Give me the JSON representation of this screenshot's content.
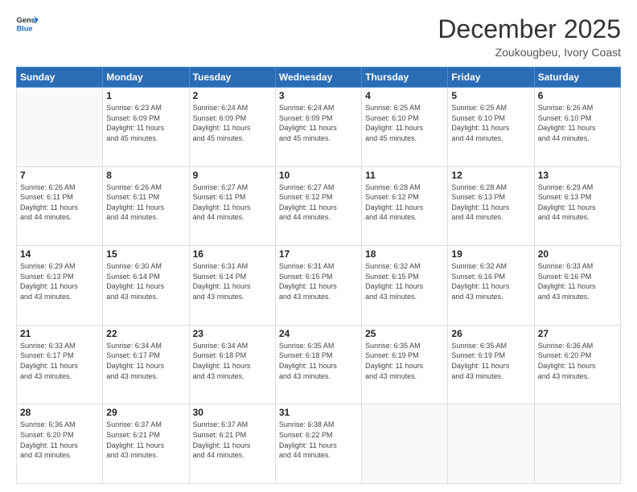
{
  "header": {
    "logo_general": "General",
    "logo_blue": "Blue",
    "title": "December 2025",
    "location": "Zoukougbeu, Ivory Coast"
  },
  "days_of_week": [
    "Sunday",
    "Monday",
    "Tuesday",
    "Wednesday",
    "Thursday",
    "Friday",
    "Saturday"
  ],
  "weeks": [
    [
      {
        "day": "",
        "info": ""
      },
      {
        "day": "1",
        "info": "Sunrise: 6:23 AM\nSunset: 6:09 PM\nDaylight: 11 hours\nand 45 minutes."
      },
      {
        "day": "2",
        "info": "Sunrise: 6:24 AM\nSunset: 6:09 PM\nDaylight: 11 hours\nand 45 minutes."
      },
      {
        "day": "3",
        "info": "Sunrise: 6:24 AM\nSunset: 6:09 PM\nDaylight: 11 hours\nand 45 minutes."
      },
      {
        "day": "4",
        "info": "Sunrise: 6:25 AM\nSunset: 6:10 PM\nDaylight: 11 hours\nand 45 minutes."
      },
      {
        "day": "5",
        "info": "Sunrise: 6:25 AM\nSunset: 6:10 PM\nDaylight: 11 hours\nand 44 minutes."
      },
      {
        "day": "6",
        "info": "Sunrise: 6:26 AM\nSunset: 6:10 PM\nDaylight: 11 hours\nand 44 minutes."
      }
    ],
    [
      {
        "day": "7",
        "info": "Sunrise: 6:26 AM\nSunset: 6:11 PM\nDaylight: 11 hours\nand 44 minutes."
      },
      {
        "day": "8",
        "info": "Sunrise: 6:26 AM\nSunset: 6:11 PM\nDaylight: 11 hours\nand 44 minutes."
      },
      {
        "day": "9",
        "info": "Sunrise: 6:27 AM\nSunset: 6:11 PM\nDaylight: 11 hours\nand 44 minutes."
      },
      {
        "day": "10",
        "info": "Sunrise: 6:27 AM\nSunset: 6:12 PM\nDaylight: 11 hours\nand 44 minutes."
      },
      {
        "day": "11",
        "info": "Sunrise: 6:28 AM\nSunset: 6:12 PM\nDaylight: 11 hours\nand 44 minutes."
      },
      {
        "day": "12",
        "info": "Sunrise: 6:28 AM\nSunset: 6:13 PM\nDaylight: 11 hours\nand 44 minutes."
      },
      {
        "day": "13",
        "info": "Sunrise: 6:29 AM\nSunset: 6:13 PM\nDaylight: 11 hours\nand 44 minutes."
      }
    ],
    [
      {
        "day": "14",
        "info": "Sunrise: 6:29 AM\nSunset: 6:13 PM\nDaylight: 11 hours\nand 43 minutes."
      },
      {
        "day": "15",
        "info": "Sunrise: 6:30 AM\nSunset: 6:14 PM\nDaylight: 11 hours\nand 43 minutes."
      },
      {
        "day": "16",
        "info": "Sunrise: 6:31 AM\nSunset: 6:14 PM\nDaylight: 11 hours\nand 43 minutes."
      },
      {
        "day": "17",
        "info": "Sunrise: 6:31 AM\nSunset: 6:15 PM\nDaylight: 11 hours\nand 43 minutes."
      },
      {
        "day": "18",
        "info": "Sunrise: 6:32 AM\nSunset: 6:15 PM\nDaylight: 11 hours\nand 43 minutes."
      },
      {
        "day": "19",
        "info": "Sunrise: 6:32 AM\nSunset: 6:16 PM\nDaylight: 11 hours\nand 43 minutes."
      },
      {
        "day": "20",
        "info": "Sunrise: 6:33 AM\nSunset: 6:16 PM\nDaylight: 11 hours\nand 43 minutes."
      }
    ],
    [
      {
        "day": "21",
        "info": "Sunrise: 6:33 AM\nSunset: 6:17 PM\nDaylight: 11 hours\nand 43 minutes."
      },
      {
        "day": "22",
        "info": "Sunrise: 6:34 AM\nSunset: 6:17 PM\nDaylight: 11 hours\nand 43 minutes."
      },
      {
        "day": "23",
        "info": "Sunrise: 6:34 AM\nSunset: 6:18 PM\nDaylight: 11 hours\nand 43 minutes."
      },
      {
        "day": "24",
        "info": "Sunrise: 6:35 AM\nSunset: 6:18 PM\nDaylight: 11 hours\nand 43 minutes."
      },
      {
        "day": "25",
        "info": "Sunrise: 6:35 AM\nSunset: 6:19 PM\nDaylight: 11 hours\nand 43 minutes."
      },
      {
        "day": "26",
        "info": "Sunrise: 6:35 AM\nSunset: 6:19 PM\nDaylight: 11 hours\nand 43 minutes."
      },
      {
        "day": "27",
        "info": "Sunrise: 6:36 AM\nSunset: 6:20 PM\nDaylight: 11 hours\nand 43 minutes."
      }
    ],
    [
      {
        "day": "28",
        "info": "Sunrise: 6:36 AM\nSunset: 6:20 PM\nDaylight: 11 hours\nand 43 minutes."
      },
      {
        "day": "29",
        "info": "Sunrise: 6:37 AM\nSunset: 6:21 PM\nDaylight: 11 hours\nand 43 minutes."
      },
      {
        "day": "30",
        "info": "Sunrise: 6:37 AM\nSunset: 6:21 PM\nDaylight: 11 hours\nand 44 minutes."
      },
      {
        "day": "31",
        "info": "Sunrise: 6:38 AM\nSunset: 6:22 PM\nDaylight: 11 hours\nand 44 minutes."
      },
      {
        "day": "",
        "info": ""
      },
      {
        "day": "",
        "info": ""
      },
      {
        "day": "",
        "info": ""
      }
    ]
  ]
}
